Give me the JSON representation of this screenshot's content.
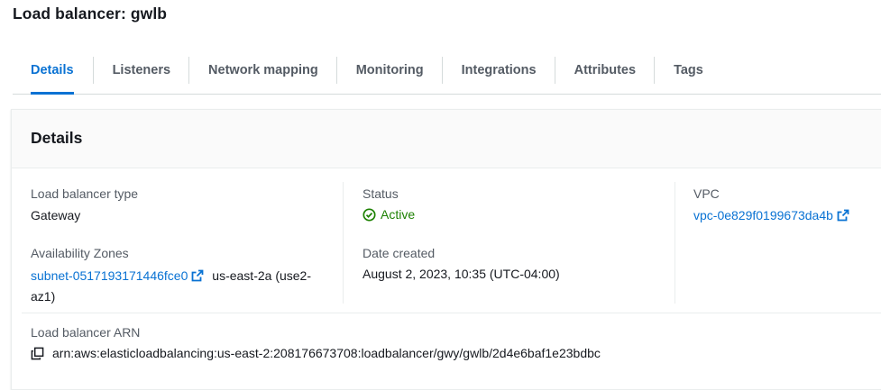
{
  "page": {
    "title": "Load balancer: gwlb"
  },
  "tabs": [
    {
      "label": "Details",
      "active": true
    },
    {
      "label": "Listeners",
      "active": false
    },
    {
      "label": "Network mapping",
      "active": false
    },
    {
      "label": "Monitoring",
      "active": false
    },
    {
      "label": "Integrations",
      "active": false
    },
    {
      "label": "Attributes",
      "active": false
    },
    {
      "label": "Tags",
      "active": false
    }
  ],
  "details": {
    "title": "Details",
    "type": {
      "label": "Load balancer type",
      "value": "Gateway"
    },
    "status": {
      "label": "Status",
      "value": "Active",
      "icon": "check-circle-icon"
    },
    "vpc": {
      "label": "VPC",
      "value": "vpc-0e829f0199673da4b",
      "icon": "external-link-icon"
    },
    "availability_zones": {
      "label": "Availability Zones",
      "subnet": "subnet-0517193171446fce0",
      "zone_line1": "us-east-2a (use2-",
      "zone_line2": "az1)"
    },
    "date_created": {
      "label": "Date created",
      "value": "August 2, 2023, 10:35 (UTC-04:00)"
    },
    "arn": {
      "label": "Load balancer ARN",
      "value": "arn:aws:elasticloadbalancing:us-east-2:208176673708:loadbalancer/gwy/gwlb/2d4e6baf1e23bdbc",
      "icon": "copy-icon"
    }
  },
  "colors": {
    "link": "#0972d3",
    "status_active": "#1d8102",
    "tab_inactive": "#545b64"
  }
}
